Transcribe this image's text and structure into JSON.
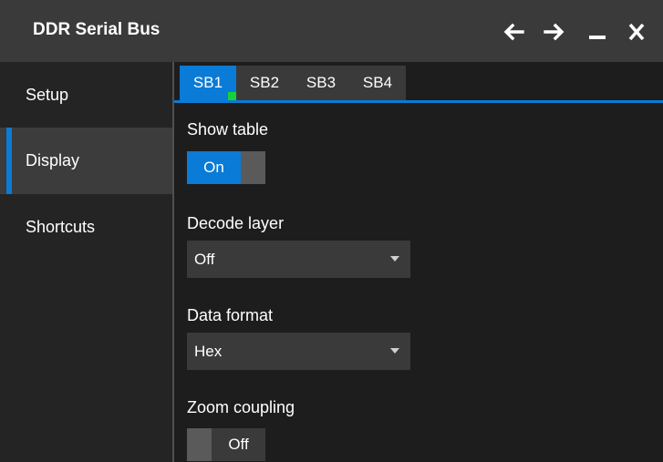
{
  "window": {
    "title": "DDR Serial Bus",
    "controls": [
      "back-arrow-icon",
      "forward-arrow-icon",
      "minimize-icon",
      "close-icon"
    ]
  },
  "sidebar": {
    "items": [
      {
        "label": "Setup",
        "active": false
      },
      {
        "label": "Display",
        "active": true
      },
      {
        "label": "Shortcuts",
        "active": false
      }
    ]
  },
  "tabs": [
    {
      "label": "SB1",
      "active": true,
      "indicator": "green-dot"
    },
    {
      "label": "SB2",
      "active": false
    },
    {
      "label": "SB3",
      "active": false
    },
    {
      "label": "SB4",
      "active": false
    }
  ],
  "settings": {
    "show_table": {
      "label": "Show table",
      "value": "On"
    },
    "decode_layer": {
      "label": "Decode layer",
      "value": "Off"
    },
    "data_format": {
      "label": "Data format",
      "value": "Hex"
    },
    "zoom_coupling": {
      "label": "Zoom coupling",
      "value": "Off"
    }
  },
  "colors": {
    "accent": "#0a7bd6",
    "indicator": "#17d138",
    "titlebar": "#3a3a3a"
  }
}
